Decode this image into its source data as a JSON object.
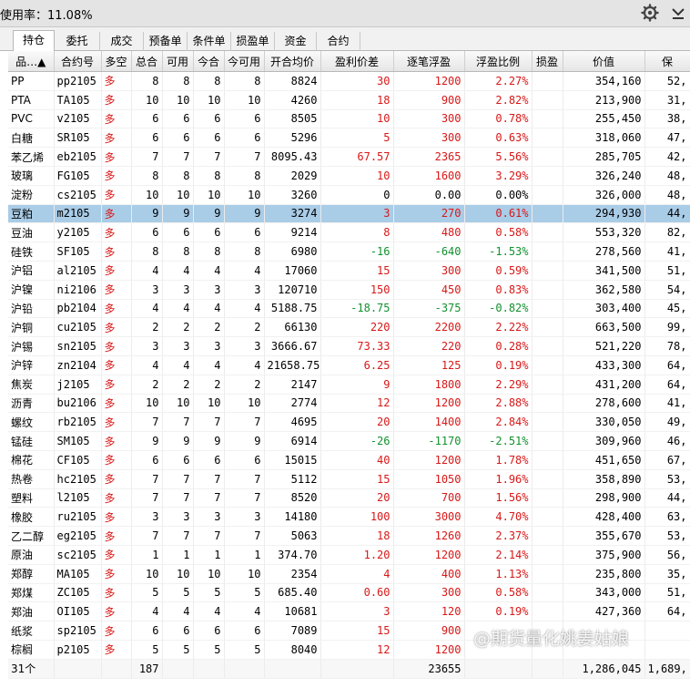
{
  "header": {
    "usage": "使用率：11.08%"
  },
  "tabs": [
    "持仓",
    "委托",
    "成交",
    "预备单",
    "条件单",
    "损盈单",
    "资金",
    "合约"
  ],
  "columns": [
    "品…▲",
    "合约号",
    "多空",
    "总合",
    "可用",
    "今合",
    "今可用",
    "开合均价",
    "盈利价差",
    "逐笔浮盈",
    "浮盈比例",
    "损盈",
    "价值",
    "保"
  ],
  "rows": [
    [
      "PP",
      "pp2105",
      "多",
      "8",
      "8",
      "8",
      "8",
      "8824",
      "30",
      "1200",
      "2.27%",
      "",
      "354,160",
      "52,"
    ],
    [
      "PTA",
      "TA105",
      "多",
      "10",
      "10",
      "10",
      "10",
      "4260",
      "18",
      "900",
      "2.82%",
      "",
      "213,900",
      "31,"
    ],
    [
      "PVC",
      "v2105",
      "多",
      "6",
      "6",
      "6",
      "6",
      "8505",
      "10",
      "300",
      "0.78%",
      "",
      "255,450",
      "38,"
    ],
    [
      "白糖",
      "SR105",
      "多",
      "6",
      "6",
      "6",
      "6",
      "5296",
      "5",
      "300",
      "0.63%",
      "",
      "318,060",
      "47,"
    ],
    [
      "苯乙烯",
      "eb2105",
      "多",
      "7",
      "7",
      "7",
      "7",
      "8095.43",
      "67.57",
      "2365",
      "5.56%",
      "",
      "285,705",
      "42,"
    ],
    [
      "玻璃",
      "FG105",
      "多",
      "8",
      "8",
      "8",
      "8",
      "2029",
      "10",
      "1600",
      "3.29%",
      "",
      "326,240",
      "48,"
    ],
    [
      "淀粉",
      "cs2105",
      "多",
      "10",
      "10",
      "10",
      "10",
      "3260",
      "0",
      "0.00",
      "0.00%",
      "",
      "326,000",
      "48,"
    ],
    [
      "豆粕",
      "m2105",
      "多",
      "9",
      "9",
      "9",
      "9",
      "3274",
      "3",
      "270",
      "0.61%",
      "",
      "294,930",
      "44,"
    ],
    [
      "豆油",
      "y2105",
      "多",
      "6",
      "6",
      "6",
      "6",
      "9214",
      "8",
      "480",
      "0.58%",
      "",
      "553,320",
      "82,"
    ],
    [
      "硅铁",
      "SF105",
      "多",
      "8",
      "8",
      "8",
      "8",
      "6980",
      "-16",
      "-640",
      "-1.53%",
      "",
      "278,560",
      "41,"
    ],
    [
      "沪铝",
      "al2105",
      "多",
      "4",
      "4",
      "4",
      "4",
      "17060",
      "15",
      "300",
      "0.59%",
      "",
      "341,500",
      "51,"
    ],
    [
      "沪镍",
      "ni2106",
      "多",
      "3",
      "3",
      "3",
      "3",
      "120710",
      "150",
      "450",
      "0.83%",
      "",
      "362,580",
      "54,"
    ],
    [
      "沪铅",
      "pb2104",
      "多",
      "4",
      "4",
      "4",
      "4",
      "5188.75",
      "-18.75",
      "-375",
      "-0.82%",
      "",
      "303,400",
      "45,"
    ],
    [
      "沪铜",
      "cu2105",
      "多",
      "2",
      "2",
      "2",
      "2",
      "66130",
      "220",
      "2200",
      "2.22%",
      "",
      "663,500",
      "99,"
    ],
    [
      "沪锡",
      "sn2105",
      "多",
      "3",
      "3",
      "3",
      "3",
      "3666.67",
      "73.33",
      "220",
      "0.28%",
      "",
      "521,220",
      "78,"
    ],
    [
      "沪锌",
      "zn2104",
      "多",
      "4",
      "4",
      "4",
      "4",
      "21658.75",
      "6.25",
      "125",
      "0.19%",
      "",
      "433,300",
      "64,"
    ],
    [
      "焦炭",
      "j2105",
      "多",
      "2",
      "2",
      "2",
      "2",
      "2147",
      "9",
      "1800",
      "2.29%",
      "",
      "431,200",
      "64,"
    ],
    [
      "沥青",
      "bu2106",
      "多",
      "10",
      "10",
      "10",
      "10",
      "2774",
      "12",
      "1200",
      "2.88%",
      "",
      "278,600",
      "41,"
    ],
    [
      "螺纹",
      "rb2105",
      "多",
      "7",
      "7",
      "7",
      "7",
      "4695",
      "20",
      "1400",
      "2.84%",
      "",
      "330,050",
      "49,"
    ],
    [
      "锰硅",
      "SM105",
      "多",
      "9",
      "9",
      "9",
      "9",
      "6914",
      "-26",
      "-1170",
      "-2.51%",
      "",
      "309,960",
      "46,"
    ],
    [
      "棉花",
      "CF105",
      "多",
      "6",
      "6",
      "6",
      "6",
      "15015",
      "40",
      "1200",
      "1.78%",
      "",
      "451,650",
      "67,"
    ],
    [
      "热卷",
      "hc2105",
      "多",
      "7",
      "7",
      "7",
      "7",
      "5112",
      "15",
      "1050",
      "1.96%",
      "",
      "358,890",
      "53,"
    ],
    [
      "塑料",
      "l2105",
      "多",
      "7",
      "7",
      "7",
      "7",
      "8520",
      "20",
      "700",
      "1.56%",
      "",
      "298,900",
      "44,"
    ],
    [
      "橡胶",
      "ru2105",
      "多",
      "3",
      "3",
      "3",
      "3",
      "14180",
      "100",
      "3000",
      "4.70%",
      "",
      "428,400",
      "63,"
    ],
    [
      "乙二醇",
      "eg2105",
      "多",
      "7",
      "7",
      "7",
      "7",
      "5063",
      "18",
      "1260",
      "2.37%",
      "",
      "355,670",
      "53,"
    ],
    [
      "原油",
      "sc2105",
      "多",
      "1",
      "1",
      "1",
      "1",
      "374.70",
      "1.20",
      "1200",
      "2.14%",
      "",
      "375,900",
      "56,"
    ],
    [
      "郑醇",
      "MA105",
      "多",
      "10",
      "10",
      "10",
      "10",
      "2354",
      "4",
      "400",
      "1.13%",
      "",
      "235,800",
      "35,"
    ],
    [
      "郑煤",
      "ZC105",
      "多",
      "5",
      "5",
      "5",
      "5",
      "685.40",
      "0.60",
      "300",
      "0.58%",
      "",
      "343,000",
      "51,"
    ],
    [
      "郑油",
      "OI105",
      "多",
      "4",
      "4",
      "4",
      "4",
      "10681",
      "3",
      "120",
      "0.19%",
      "",
      "427,360",
      "64,"
    ],
    [
      "纸浆",
      "sp2105",
      "多",
      "6",
      "6",
      "6",
      "6",
      "7089",
      "15",
      "900",
      "",
      "",
      "",
      ""
    ],
    [
      "棕榈",
      "p2105",
      "多",
      "5",
      "5",
      "5",
      "5",
      "8040",
      "12",
      "1200",
      "",
      "",
      "",
      ""
    ]
  ],
  "selected_row": 7,
  "footer": [
    "31个",
    "",
    "",
    "187",
    "",
    "",
    "",
    "",
    "",
    "23655",
    "",
    "",
    "1,286,045",
    "1,689,"
  ],
  "watermark": "@期货量化姚姜姑娘",
  "colors": {
    "positive": "#d81818",
    "negative": "#12912e",
    "selected_row": "#a9cce7",
    "toolbar": "#e4e4e4"
  },
  "icons": [
    "gear-icon",
    "chevron-down-icon"
  ]
}
